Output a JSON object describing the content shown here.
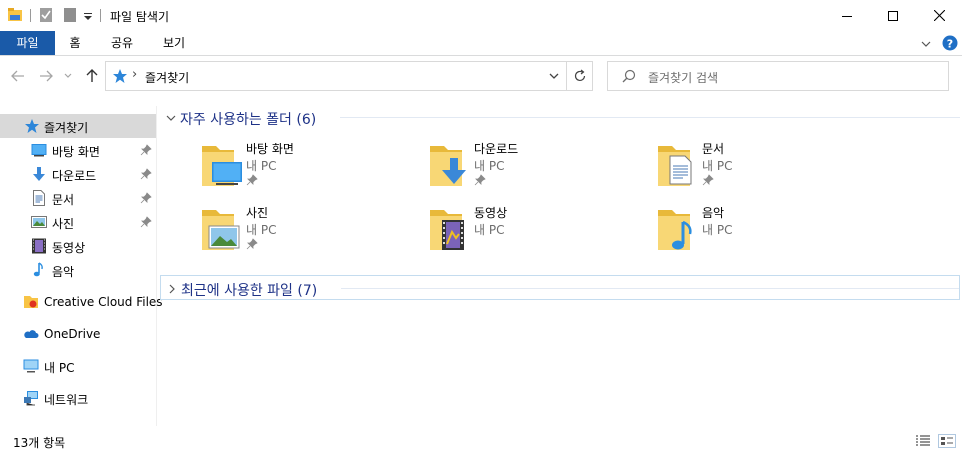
{
  "titlebar": {
    "title": "파일 탐색기",
    "icons": [
      "file-explorer-icon",
      "properties-icon",
      "new-folder-icon",
      "customize-dropdown-icon"
    ],
    "controls": [
      "minimize-icon",
      "maximize-icon",
      "close-icon"
    ]
  },
  "ribbon": {
    "tabs": [
      {
        "label": "파일",
        "active": true
      },
      {
        "label": "홈"
      },
      {
        "label": "공유"
      },
      {
        "label": "보기"
      }
    ],
    "accent": "#1a5aa8"
  },
  "address": {
    "path": "즐겨찾기",
    "separator": "›"
  },
  "search": {
    "placeholder": "즐겨찾기 검색"
  },
  "navpane": {
    "items": [
      {
        "label": "즐겨찾기",
        "icon": "star-icon",
        "selected": true
      },
      {
        "label": "바탕 화면",
        "icon": "desktop-icon",
        "pinned": true
      },
      {
        "label": "다운로드",
        "icon": "download-icon",
        "pinned": true
      },
      {
        "label": "문서",
        "icon": "document-icon",
        "pinned": true
      },
      {
        "label": "사진",
        "icon": "pictures-icon",
        "pinned": true
      },
      {
        "label": "동영상",
        "icon": "video-icon"
      },
      {
        "label": "음악",
        "icon": "music-icon"
      },
      {
        "label": "Creative Cloud Files",
        "icon": "creative-cloud-icon"
      },
      {
        "label": "OneDrive",
        "icon": "onedrive-icon"
      },
      {
        "label": "내 PC",
        "icon": "pc-icon"
      },
      {
        "label": "네트워크",
        "icon": "network-icon"
      }
    ]
  },
  "main": {
    "groups": [
      {
        "label": "자주 사용하는 폴더 (6)",
        "expanded": true
      },
      {
        "label": "최근에 사용한 파일 (7)",
        "expanded": false
      }
    ],
    "folders": [
      {
        "name": "바탕 화면",
        "location": "내 PC",
        "pinned": true
      },
      {
        "name": "다운로드",
        "location": "내 PC",
        "pinned": true
      },
      {
        "name": "문서",
        "location": "내 PC",
        "pinned": true
      },
      {
        "name": "사진",
        "location": "내 PC",
        "pinned": true
      },
      {
        "name": "동영상",
        "location": "내 PC"
      },
      {
        "name": "음악",
        "location": "내 PC"
      }
    ]
  },
  "status": {
    "text": "13개 항목"
  }
}
